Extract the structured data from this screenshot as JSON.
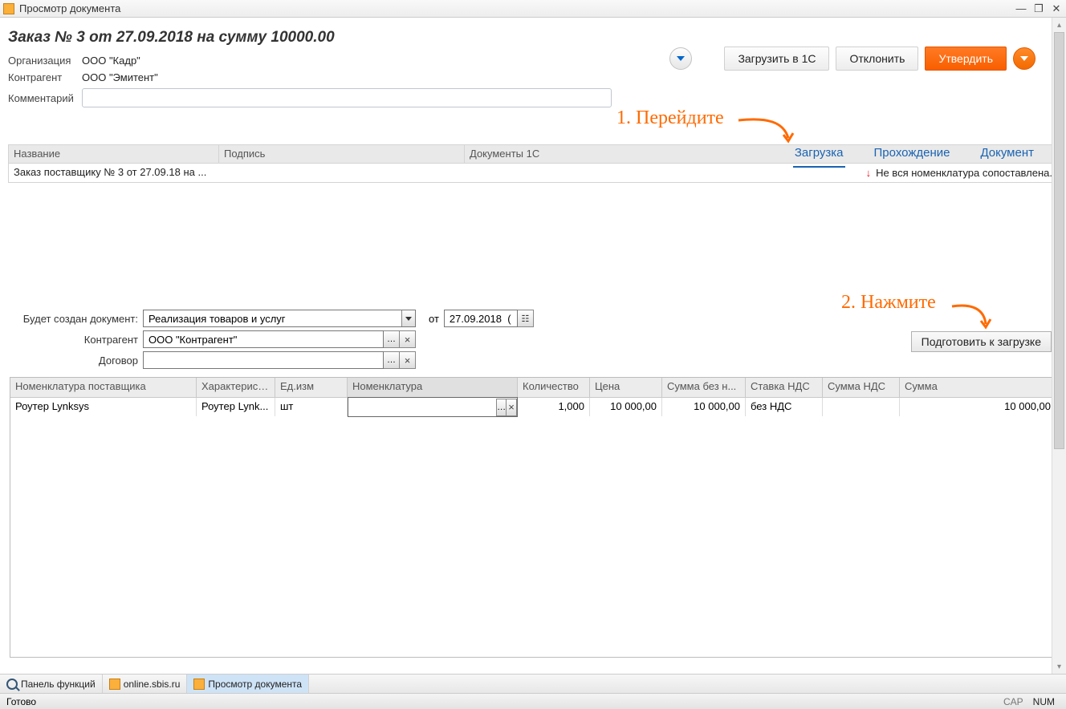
{
  "window": {
    "title": "Просмотр документа"
  },
  "order": {
    "title": "Заказ № 3 от 27.09.2018 на сумму 10000.00",
    "labels": {
      "org": "Организация",
      "counterparty": "Контрагент",
      "comment": "Комментарий"
    },
    "org": "ООО \"Кадр\"",
    "counterparty": "ООО \"Эмитент\"",
    "comment": ""
  },
  "actions": {
    "load1c": "Загрузить в 1С",
    "reject": "Отклонить",
    "approve": "Утвердить"
  },
  "tabs": {
    "load": "Загрузка",
    "pass": "Прохождение",
    "doc": "Документ"
  },
  "grid": {
    "head": {
      "name": "Название",
      "sign": "Подпись",
      "doc1c": "Документы 1С"
    },
    "row": {
      "name": "Заказ поставщику № 3 от 27.09.18 на ...",
      "status": "Не вся номенклатура сопоставлена."
    }
  },
  "form": {
    "labels": {
      "willcreate": "Будет создан документ:",
      "from": "от",
      "counterparty": "Контрагент",
      "contract": "Договор"
    },
    "doc_type": "Реализация товаров и услуг",
    "date": "27.09.2018  (",
    "counterparty": "ООО \"Контрагент\"",
    "contract": "",
    "prepare_btn": "Подготовить к загрузке"
  },
  "items": {
    "head": {
      "supplier_nom": "Номенклатура поставщика",
      "char": "Характерист...",
      "unit": "Ед.изм",
      "nom": "Номенклатура",
      "qty": "Количество",
      "price": "Цена",
      "sum_wo": "Сумма без н...",
      "vat_rate": "Ставка НДС",
      "vat_sum": "Сумма НДС",
      "sum": "Сумма"
    },
    "row": {
      "supplier_nom": "Роутер Lynksys",
      "char": "Роутер Lynk...",
      "unit": "шт",
      "nom": "",
      "qty": "1,000",
      "price": "10 000,00",
      "sum_wo": "10 000,00",
      "vat_rate": "без НДС",
      "vat_sum": "",
      "sum": "10 000,00"
    }
  },
  "annot": {
    "a1": "1. Перейдите",
    "a2": "2. Нажмите"
  },
  "taskbar": {
    "fns": "Панель функций",
    "online": "online.sbis.ru",
    "view": "Просмотр документа"
  },
  "status": {
    "ready": "Готово",
    "cap": "CAP",
    "num": "NUM"
  }
}
